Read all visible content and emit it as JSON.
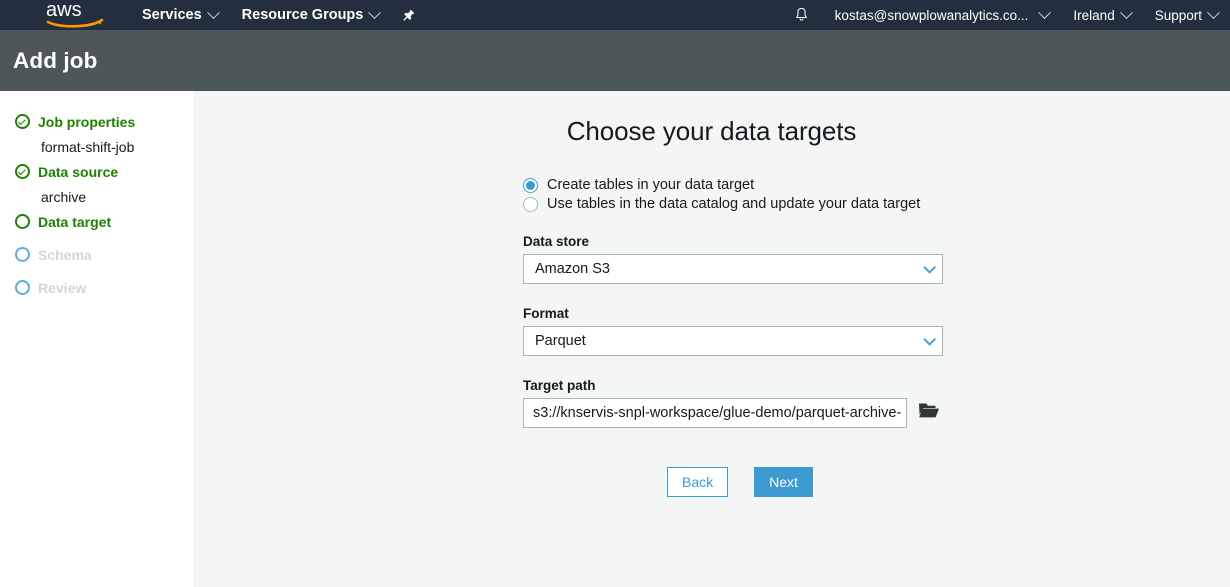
{
  "navbar": {
    "logo_alt": "aws",
    "left_items": [
      {
        "label": "Services",
        "has_caret": true
      },
      {
        "label": "Resource Groups",
        "has_caret": true
      }
    ],
    "pin_icon": "pushpin-icon",
    "bell_icon": "notifications-bell-icon",
    "right_items": [
      {
        "label": "kostas@snowplowanalytics.co...",
        "has_caret": true
      },
      {
        "label": "Ireland",
        "has_caret": true
      },
      {
        "label": "Support",
        "has_caret": true
      }
    ]
  },
  "titlebar": {
    "title": "Add job"
  },
  "sidebar": {
    "steps": [
      {
        "label": "Job properties",
        "state": "done",
        "sub": "format-shift-job"
      },
      {
        "label": "Data source",
        "state": "done",
        "sub": "archive"
      },
      {
        "label": "Data target",
        "state": "current",
        "sub": ""
      },
      {
        "label": "Schema",
        "state": "todo",
        "sub": ""
      },
      {
        "label": "Review",
        "state": "todo",
        "sub": ""
      }
    ]
  },
  "main": {
    "heading": "Choose your data targets",
    "radios": [
      {
        "label": "Create tables in your data target",
        "checked": true
      },
      {
        "label": "Use tables in the data catalog and update your data target",
        "checked": false
      }
    ],
    "fields": {
      "data_store_label": "Data store",
      "data_store_value": "Amazon S3",
      "format_label": "Format",
      "format_value": "Parquet",
      "target_path_label": "Target path",
      "target_path_value": "s3://knservis-snpl-workspace/glue-demo/parquet-archive-",
      "browse_icon": "folder-open-icon"
    },
    "buttons": {
      "back": "Back",
      "next": "Next"
    }
  },
  "colors": {
    "nav_bg": "#232f3e",
    "title_bg": "#4d5659",
    "content_bg": "#f4f5f5",
    "accent_blue": "#3d9ad1",
    "step_green": "#1d8102",
    "aws_orange": "#ff9900"
  }
}
